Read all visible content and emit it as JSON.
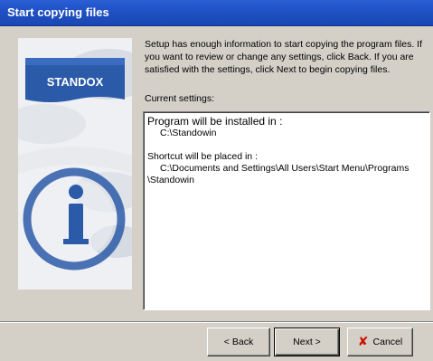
{
  "window": {
    "title": "Start copying files"
  },
  "description": "Setup has enough information to start copying the program files. If you want to review or change any settings, click Back. If you are satisfied with the settings, click Next to begin copying files.",
  "current_settings_label": "Current settings:",
  "settings": {
    "install_heading": "Program will be installed in :",
    "install_path": "C:\\Standowin",
    "shortcut_heading": "Shortcut will be placed in :",
    "shortcut_path_line1": "C:\\Documents and Settings\\All Users\\Start Menu\\Programs",
    "shortcut_path_line2": "\\Standowin"
  },
  "logo": {
    "brand": "STANDOX"
  },
  "buttons": {
    "back": "< Back",
    "next": "Next >",
    "cancel": "Cancel"
  },
  "colors": {
    "titlebar": "#1f50c4",
    "logo_blue": "#2b5aa8",
    "cancel_icon": "#cc1100"
  }
}
